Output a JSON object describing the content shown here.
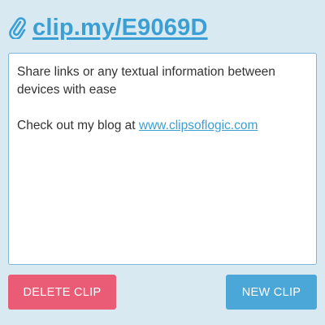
{
  "header": {
    "icon": "paperclip-icon",
    "link_text": "clip.my/E9069D"
  },
  "clip": {
    "line1": "Share links or any textual information between devices with ease",
    "line2_prefix": "Check out my blog at ",
    "line2_link": "www.clipsoflogic.com"
  },
  "buttons": {
    "delete_label": "DELETE CLIP",
    "new_label": "NEW CLIP"
  },
  "colors": {
    "background": "#d9e9f2",
    "accent": "#3b9fd4",
    "delete": "#ea5b76",
    "new": "#4aa7d8"
  }
}
